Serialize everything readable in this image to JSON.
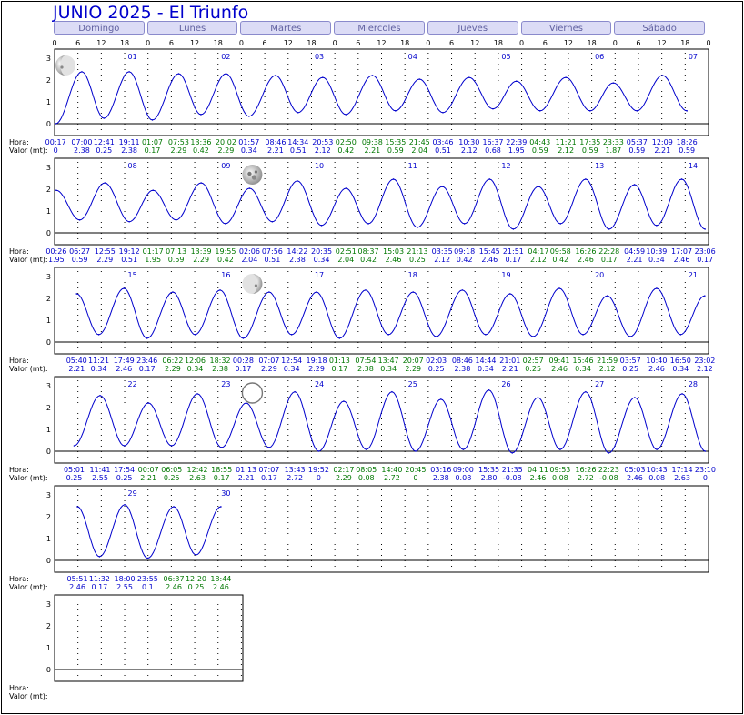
{
  "title": "JUNIO 2025 - El Triunfo",
  "day_headers": [
    "Domingo",
    "Lunes",
    "Martes",
    "Miercoles",
    "Jueves",
    "Viernes",
    "Sábado"
  ],
  "hour_ticks": [
    "0",
    "6",
    "12",
    "18"
  ],
  "last_tick": "0",
  "y_ticks": [
    "0",
    "1",
    "2",
    "3"
  ],
  "hora_label": "Hora:",
  "valor_label": "Valor (mt):",
  "colors": {
    "curve": "#0000cc",
    "time_a": "#0000cc",
    "time_b": "#007700",
    "title": "#0000cc"
  },
  "chart_data": {
    "type": "line",
    "xunit": "hours from week start (Sunday 00:00)",
    "ylim": [
      0,
      3
    ],
    "rows": [
      {
        "day_numbers": [
          "01",
          "02",
          "03",
          "04",
          "05",
          "06",
          "07"
        ],
        "moon": {
          "phase": "first-quarter",
          "day_index": 1
        },
        "extremes": [
          [
            "00:17",
            "0"
          ],
          [
            "07:00",
            "2.38"
          ],
          [
            "12:41",
            "0.25"
          ],
          [
            "19:11",
            "2.38"
          ],
          [
            "01:07",
            "0.17"
          ],
          [
            "07:53",
            "2.29"
          ],
          [
            "13:36",
            "0.42"
          ],
          [
            "20:02",
            "2.29"
          ],
          [
            "01:57",
            "0.34"
          ],
          [
            "08:46",
            "2.21"
          ],
          [
            "14:34",
            "0.51"
          ],
          [
            "20:53",
            "2.12"
          ],
          [
            "02:50",
            "0.42"
          ],
          [
            "09:38",
            "2.21"
          ],
          [
            "15:35",
            "0.59"
          ],
          [
            "21:45",
            "2.04"
          ],
          [
            "03:46",
            "0.51"
          ],
          [
            "10:30",
            "2.12"
          ],
          [
            "16:37",
            "0.68"
          ],
          [
            "22:39",
            "1.95"
          ],
          [
            "04:43",
            "0.59"
          ],
          [
            "11:21",
            "2.12"
          ],
          [
            "17:35",
            "0.59"
          ],
          [
            "23:33",
            "1.87"
          ],
          [
            "05:37",
            "0.59"
          ],
          [
            "12:09",
            "2.21"
          ],
          [
            "18:26",
            "0.59"
          ]
        ]
      },
      {
        "day_numbers": [
          "08",
          "09",
          "10",
          "11",
          "12",
          "13",
          "14"
        ],
        "moon": {
          "phase": "full",
          "day_index": 10
        },
        "extremes": [
          [
            "00:26",
            "1.95"
          ],
          [
            "06:27",
            "0.59"
          ],
          [
            "12:55",
            "2.29"
          ],
          [
            "19:12",
            "0.51"
          ],
          [
            "01:17",
            "1.95"
          ],
          [
            "07:13",
            "0.59"
          ],
          [
            "13:39",
            "2.29"
          ],
          [
            "19:55",
            "0.42"
          ],
          [
            "02:06",
            "2.04"
          ],
          [
            "07:56",
            "0.51"
          ],
          [
            "14:22",
            "2.38"
          ],
          [
            "20:35",
            "0.34"
          ],
          [
            "02:51",
            "2.04"
          ],
          [
            "08:37",
            "0.42"
          ],
          [
            "15:03",
            "2.46"
          ],
          [
            "21:13",
            "0.25"
          ],
          [
            "03:35",
            "2.12"
          ],
          [
            "09:18",
            "0.42"
          ],
          [
            "15:45",
            "2.46"
          ],
          [
            "21:51",
            "0.17"
          ],
          [
            "04:17",
            "2.12"
          ],
          [
            "09:58",
            "0.42"
          ],
          [
            "16:26",
            "2.46"
          ],
          [
            "22:28",
            "0.17"
          ],
          [
            "04:59",
            "2.21"
          ],
          [
            "10:39",
            "0.34"
          ],
          [
            "17:07",
            "2.46"
          ],
          [
            "23:06",
            "0.17"
          ]
        ]
      },
      {
        "day_numbers": [
          "15",
          "16",
          "17",
          "18",
          "19",
          "20",
          "21"
        ],
        "moon": {
          "phase": "last-quarter",
          "day_index": 17
        },
        "extremes": [
          [
            "05:40",
            "2.21"
          ],
          [
            "11:21",
            "0.34"
          ],
          [
            "17:49",
            "2.46"
          ],
          [
            "23:46",
            "0.17"
          ],
          [
            "06:22",
            "2.29"
          ],
          [
            "12:06",
            "0.34"
          ],
          [
            "18:32",
            "2.38"
          ],
          [
            "00:28",
            "0.17"
          ],
          [
            "07:07",
            "2.29"
          ],
          [
            "12:54",
            "0.34"
          ],
          [
            "19:18",
            "2.29"
          ],
          [
            "01:13",
            "0.17"
          ],
          [
            "07:54",
            "2.38"
          ],
          [
            "13:47",
            "0.34"
          ],
          [
            "20:07",
            "2.29"
          ],
          [
            "02:03",
            "0.25"
          ],
          [
            "08:46",
            "2.38"
          ],
          [
            "14:44",
            "0.34"
          ],
          [
            "21:01",
            "2.21"
          ],
          [
            "02:57",
            "0.25"
          ],
          [
            "09:41",
            "2.46"
          ],
          [
            "15:46",
            "0.34"
          ],
          [
            "21:59",
            "2.12"
          ],
          [
            "03:57",
            "0.25"
          ],
          [
            "10:40",
            "2.46"
          ],
          [
            "16:50",
            "0.34"
          ],
          [
            "23:02",
            "2.12"
          ]
        ]
      },
      {
        "day_numbers": [
          "22",
          "23",
          "24",
          "25",
          "26",
          "27",
          "28"
        ],
        "moon": {
          "phase": "new",
          "day_index": 24
        },
        "extremes": [
          [
            "05:01",
            "0.25"
          ],
          [
            "11:41",
            "2.55"
          ],
          [
            "17:54",
            "0.25"
          ],
          [
            "00:07",
            "2.21"
          ],
          [
            "06:05",
            "0.25"
          ],
          [
            "12:42",
            "2.63"
          ],
          [
            "18:55",
            "0.17"
          ],
          [
            "01:13",
            "2.21"
          ],
          [
            "07:07",
            "0.17"
          ],
          [
            "13:43",
            "2.72"
          ],
          [
            "19:52",
            "0"
          ],
          [
            "02:17",
            "2.29"
          ],
          [
            "08:05",
            "0.08"
          ],
          [
            "14:40",
            "2.72"
          ],
          [
            "20:45",
            "0"
          ],
          [
            "03:16",
            "2.38"
          ],
          [
            "09:00",
            "0.08"
          ],
          [
            "15:35",
            "2.80"
          ],
          [
            "21:35",
            "-0.08"
          ],
          [
            "04:11",
            "2.46"
          ],
          [
            "09:53",
            "0.08"
          ],
          [
            "16:26",
            "2.72"
          ],
          [
            "22:23",
            "-0.08"
          ],
          [
            "05:03",
            "2.46"
          ],
          [
            "10:43",
            "0.08"
          ],
          [
            "17:14",
            "2.63"
          ],
          [
            "23:10",
            "0"
          ]
        ]
      },
      {
        "day_numbers": [
          "29",
          "30"
        ],
        "moon": null,
        "extremes": [
          [
            "05:51",
            "2.46"
          ],
          [
            "11:32",
            "0.17"
          ],
          [
            "18:00",
            "2.55"
          ],
          [
            "23:55",
            "0.1"
          ],
          [
            "06:37",
            "2.46"
          ],
          [
            "12:20",
            "0.25"
          ],
          [
            "18:44",
            "2.46"
          ]
        ]
      },
      {
        "day_numbers": [],
        "moon": null,
        "extremes": []
      }
    ]
  }
}
